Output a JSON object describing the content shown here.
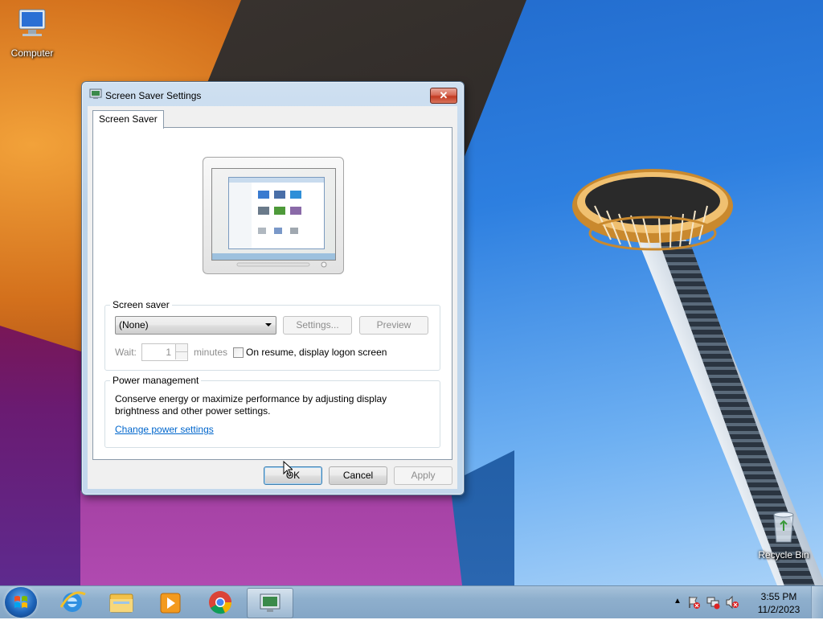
{
  "desktop": {
    "icons": {
      "computer": "Computer",
      "recycle_bin": "Recycle Bin"
    }
  },
  "dialog": {
    "title": "Screen Saver Settings",
    "close_icon": "close-icon",
    "tab_label": "Screen Saver",
    "screen_saver_group": {
      "label": "Screen saver",
      "selected": "(None)",
      "settings_label": "Settings...",
      "preview_label": "Preview",
      "wait_label": "Wait:",
      "wait_value": "1",
      "minutes_label": "minutes",
      "resume_label": "On resume, display logon screen",
      "resume_checked": false
    },
    "power_group": {
      "label": "Power management",
      "description_line1": "Conserve energy or maximize performance by adjusting display",
      "description_line2": "brightness and other power settings.",
      "link_label": "Change power settings"
    },
    "buttons": {
      "ok": "OK",
      "cancel": "Cancel",
      "apply": "Apply"
    }
  },
  "taskbar": {
    "start_icon": "windows-start-icon",
    "pinned": [
      "internet-explorer-icon",
      "file-explorer-icon",
      "media-player-icon",
      "chrome-icon",
      "screen-saver-settings-icon"
    ],
    "tray_icons": [
      "show-hidden-icons-chevron",
      "action-center-flag-icon",
      "network-icon",
      "volume-muted-icon"
    ],
    "time": "3:55 PM",
    "date": "11/2/2023"
  }
}
